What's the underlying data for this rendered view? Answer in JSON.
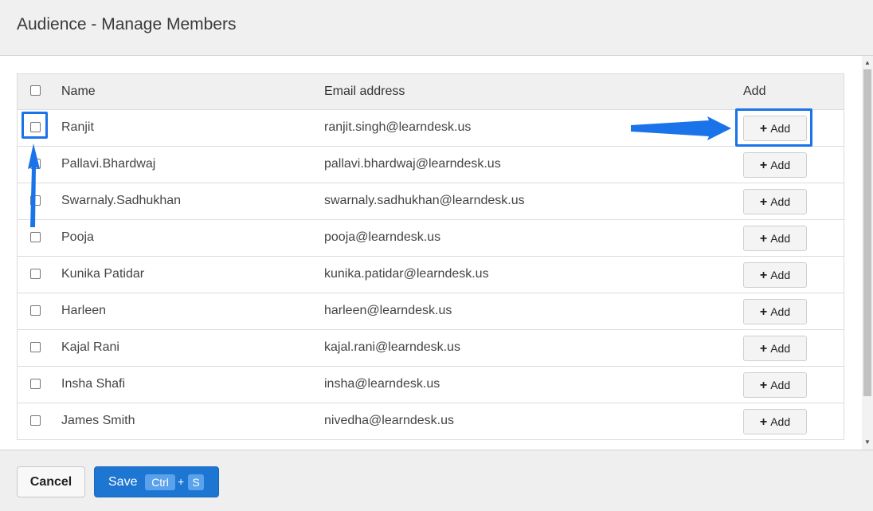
{
  "dialog": {
    "title": "Audience - Manage Members"
  },
  "table": {
    "columns": {
      "name": "Name",
      "email": "Email address",
      "add": "Add"
    },
    "add_label": "Add",
    "rows": [
      {
        "name": "Ranjit",
        "email": "ranjit.singh@learndesk.us"
      },
      {
        "name": "Pallavi.Bhardwaj",
        "email": "pallavi.bhardwaj@learndesk.us"
      },
      {
        "name": "Swarnaly.Sadhukhan",
        "email": "swarnaly.sadhukhan@learndesk.us"
      },
      {
        "name": "Pooja",
        "email": "pooja@learndesk.us"
      },
      {
        "name": "Kunika Patidar",
        "email": "kunika.patidar@learndesk.us"
      },
      {
        "name": "Harleen",
        "email": "harleen@learndesk.us"
      },
      {
        "name": "Kajal Rani",
        "email": "kajal.rani@learndesk.us"
      },
      {
        "name": "Insha Shafi",
        "email": "insha@learndesk.us"
      },
      {
        "name": "James Smith",
        "email": "nivedha@learndesk.us"
      }
    ]
  },
  "footer": {
    "cancel_label": "Cancel",
    "save_label": "Save",
    "shortcut_ctrl": "Ctrl",
    "shortcut_plus": "+",
    "shortcut_key": "S"
  },
  "colors": {
    "accent": "#1e76d3",
    "highlight": "#1a73e8"
  },
  "icons": {
    "add": "plus-icon"
  }
}
